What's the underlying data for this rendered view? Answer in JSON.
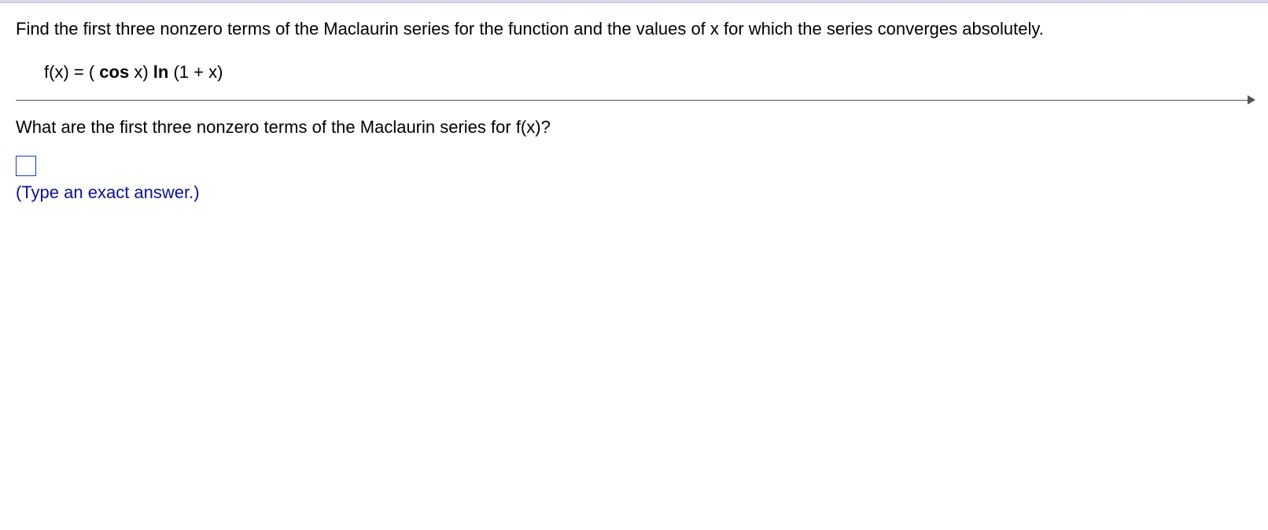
{
  "problem": {
    "statement": "Find the first three nonzero terms of the Maclaurin series for the function and the values of x for which the series converges absolutely.",
    "function_lhs": "f(x) = ( ",
    "function_cos": "cos",
    "function_mid": " x) ",
    "function_ln": "ln",
    "function_rhs": " (1 + x)"
  },
  "question": "What are the first three nonzero terms of the Maclaurin series for f(x)?",
  "answer_input": {
    "value": ""
  },
  "hint": "(Type an exact answer.)"
}
